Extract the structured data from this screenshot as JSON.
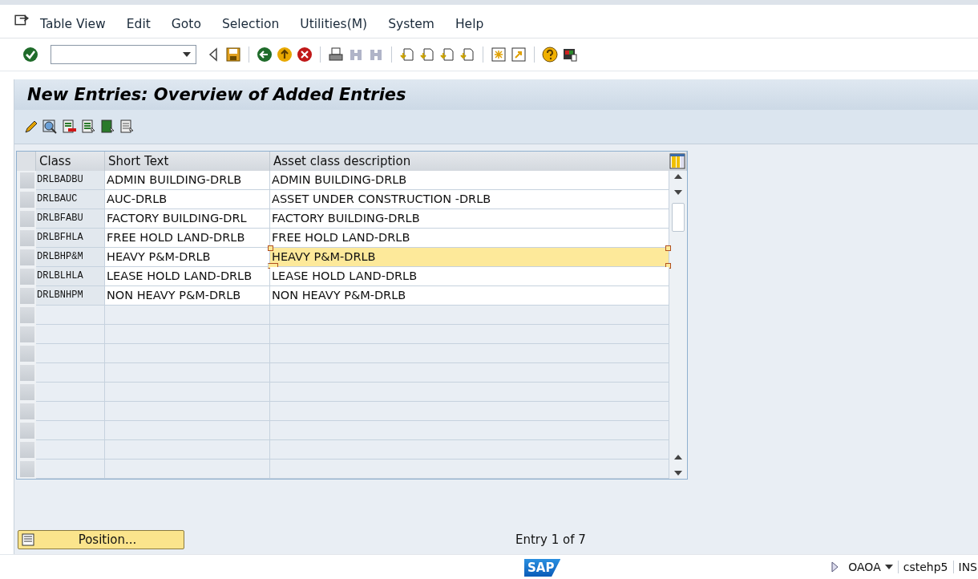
{
  "menu": [
    "Table View",
    "Edit",
    "Goto",
    "Selection",
    "Utilities(M)",
    "System",
    "Help"
  ],
  "screen_title": "New Entries: Overview of Added Entries",
  "table": {
    "columns": [
      "Class",
      "Short Text",
      "Asset class description"
    ],
    "rows": [
      {
        "class": "DRLBADBU",
        "short_text": "ADMIN BUILDING-DRLB",
        "description": "ADMIN BUILDING-DRLB",
        "focused": false
      },
      {
        "class": "DRLBAUC",
        "short_text": "AUC-DRLB",
        "description": "ASSET UNDER CONSTRUCTION -DRLB",
        "focused": false
      },
      {
        "class": "DRLBFABU",
        "short_text": "FACTORY BUILDING-DRL",
        "description": "FACTORY BUILDING-DRLB",
        "focused": false
      },
      {
        "class": "DRLBFHLA",
        "short_text": "FREE HOLD LAND-DRLB",
        "description": "FREE HOLD LAND-DRLB",
        "focused": false
      },
      {
        "class": "DRLBHP&M",
        "short_text": "HEAVY P&M-DRLB",
        "description": "HEAVY P&M-DRLB",
        "focused": true
      },
      {
        "class": "DRLBLHLA",
        "short_text": "LEASE HOLD LAND-DRLB",
        "description": "LEASE HOLD LAND-DRLB",
        "focused": false
      },
      {
        "class": "DRLBNHPM",
        "short_text": "NON HEAVY P&M-DRLB",
        "description": "NON HEAVY P&M-DRLB",
        "focused": false
      }
    ]
  },
  "position_button": "Position...",
  "entry_info": "Entry 1 of 7",
  "status_bar": {
    "logo": "SAP",
    "transaction": "OAOA",
    "server": "cstehp5",
    "mode": "INS"
  }
}
